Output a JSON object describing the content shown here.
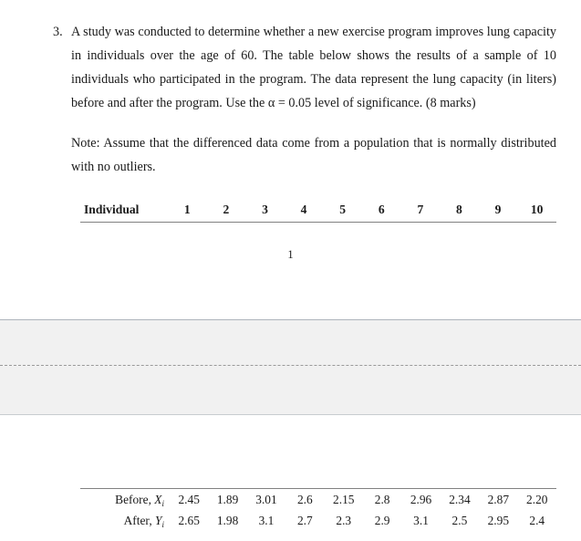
{
  "document": {
    "page_number": "1"
  },
  "question": {
    "number": "3.",
    "text": "A study was conducted to determine whether a new exercise program improves lung capacity in individuals over the age of 60. The table below shows the results of a sample of 10 individuals who participated in the program. The data represent the lung capacity (in liters) before and after the program. Use the α = 0.05 level of significance. (8 marks)",
    "note": "Note: Assume that the differenced data come from a population that is normally distributed with no outliers."
  },
  "table": {
    "header_label": "Individual",
    "individuals": [
      "1",
      "2",
      "3",
      "4",
      "5",
      "6",
      "7",
      "8",
      "9",
      "10"
    ],
    "rows": [
      {
        "label_prefix": "Before, ",
        "label_var": "X",
        "label_sub": "i",
        "values": [
          "2.45",
          "1.89",
          "3.01",
          "2.6",
          "2.15",
          "2.8",
          "2.96",
          "2.34",
          "2.87",
          "2.20"
        ]
      },
      {
        "label_prefix": "After, ",
        "label_var": "Y",
        "label_sub": "i",
        "values": [
          "2.65",
          "1.98",
          "3.1",
          "2.7",
          "2.3",
          "2.9",
          "3.1",
          "2.5",
          "2.95",
          "2.4"
        ]
      }
    ]
  },
  "colors": {
    "page_background": "#ffffff",
    "gap_background": "#f1f1f1",
    "rule": "#808080",
    "text": "#1a1a1a"
  }
}
